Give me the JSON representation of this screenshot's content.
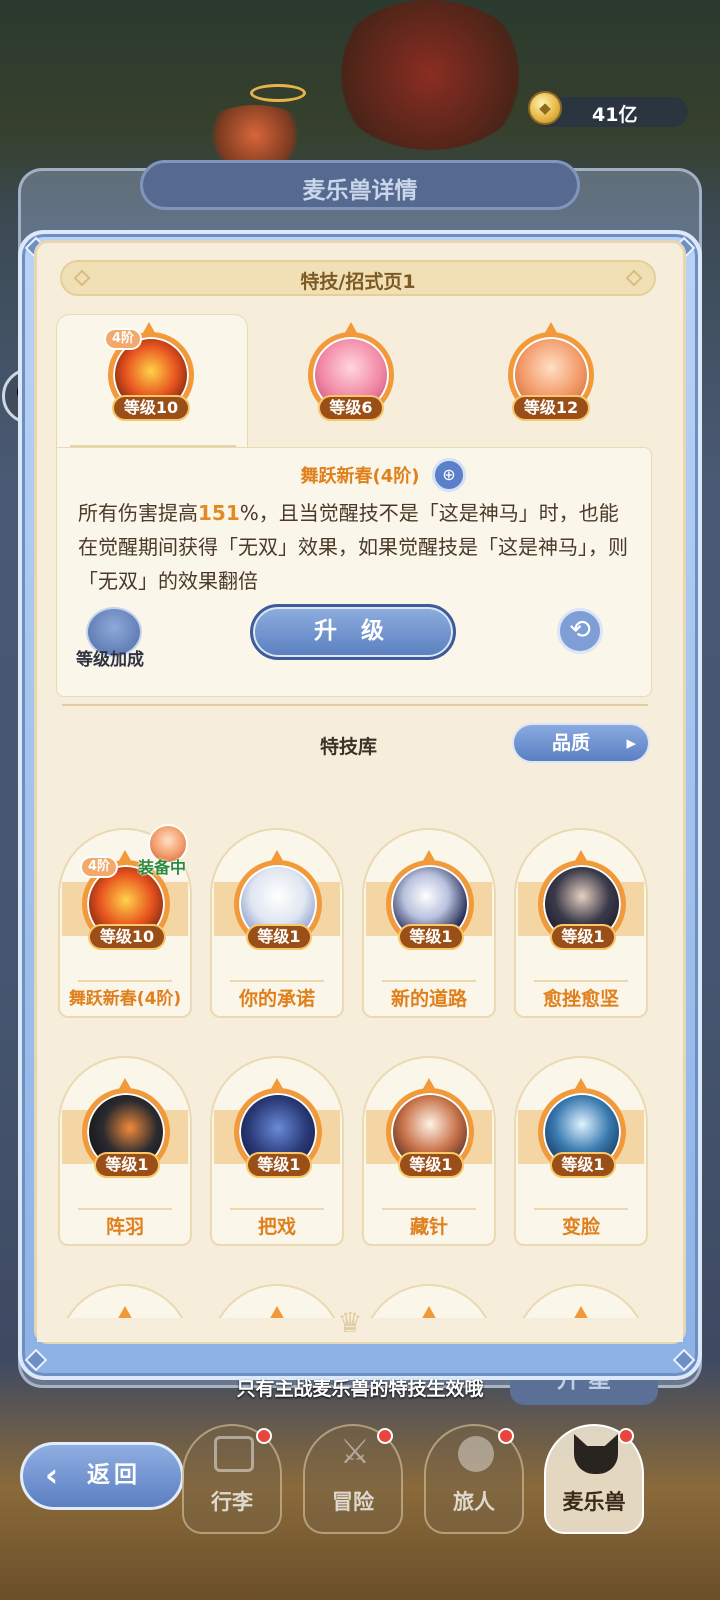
{
  "currency": {
    "amount": "41亿"
  },
  "background": {
    "title": "麦乐兽详情",
    "star_button": "升 星"
  },
  "header": {
    "title": "特技/招式页1"
  },
  "slots": [
    {
      "stage": "4阶",
      "level": "等级10"
    },
    {
      "level": "等级6"
    },
    {
      "level": "等级12"
    }
  ],
  "detail": {
    "name": "舞跃新春(4阶)",
    "desc_pre": "所有伤害提高",
    "desc_hl": "151",
    "desc_post": "%，且当觉醒技不是「这是神马」时，也能在觉醒期间获得「无双」效果，如果觉醒技是「这是神马」，则「无双」的效果翻倍",
    "level_bonus_label": "等级加成",
    "upgrade_label": "升 级"
  },
  "library": {
    "title": "特技库",
    "quality_label": "品质",
    "cards": [
      {
        "name": "舞跃新春(4阶)",
        "level": "等级10",
        "stage": "4阶",
        "equipped": "装备中"
      },
      {
        "name": "你的承诺",
        "level": "等级1"
      },
      {
        "name": "新的道路",
        "level": "等级1"
      },
      {
        "name": "愈挫愈坚",
        "level": "等级1"
      },
      {
        "name": "阵羽",
        "level": "等级1"
      },
      {
        "name": "把戏",
        "level": "等级1"
      },
      {
        "name": "藏针",
        "level": "等级1"
      },
      {
        "name": "变脸",
        "level": "等级1"
      }
    ]
  },
  "tip": "只有主战麦乐兽的特技生效哦",
  "nav": {
    "back_label": "返回",
    "items": [
      {
        "label": "行李"
      },
      {
        "label": "冒险"
      },
      {
        "label": "旅人"
      },
      {
        "label": "麦乐兽"
      }
    ]
  },
  "colors": {
    "accent": "#f29a3a",
    "primary_blue": "#5a7fc0",
    "panel": "#f6eedb",
    "highlight": "#e38a22"
  },
  "icons": [
    "coin-icon",
    "chat-icon",
    "magnify-icon",
    "rocket-icon",
    "refresh-icon",
    "back-arrow-icon",
    "bag-icon",
    "swords-icon",
    "traveler-icon",
    "beast-icon"
  ]
}
